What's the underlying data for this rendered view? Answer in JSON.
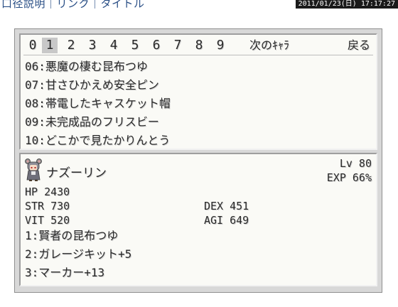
{
  "header": {
    "nav_text": "口径説明｜リンク｜タイトル",
    "timestamp": "2011/01/23(日) 17:17:27"
  },
  "tabs": [
    "0",
    "1",
    "2",
    "3",
    "4",
    "5",
    "6",
    "7",
    "8",
    "9"
  ],
  "active_tab": "1",
  "next_char_label": "次のｷｬﾗ",
  "back_label": "戻る",
  "items": [
    "06:悪魔の棲む昆布つゆ",
    "07:甘さひかえめ安全ピン",
    "08:帯電したキャスケット帽",
    "09:未完成品のフリスビー",
    "10:どこかで見たかりんとう"
  ],
  "character": {
    "sprite_icon": "mouse-girl-sprite-icon",
    "name": "ナズーリン",
    "level": "Lv 80",
    "exp": "EXP 66%",
    "hp": "HP  2430",
    "str": "STR 730",
    "dex": "DEX 451",
    "vit": "VIT 520",
    "agi": "AGI 649",
    "equipment": [
      "1:賢者の昆布つゆ",
      "2:ガレージキット+5",
      "3:マーカー+13"
    ]
  },
  "colors": {
    "window_bg": "#d8d8d8",
    "panel_bg": "#fafaf6",
    "text": "#2a2a2a",
    "tab_highlight": "#c8c8c8"
  }
}
